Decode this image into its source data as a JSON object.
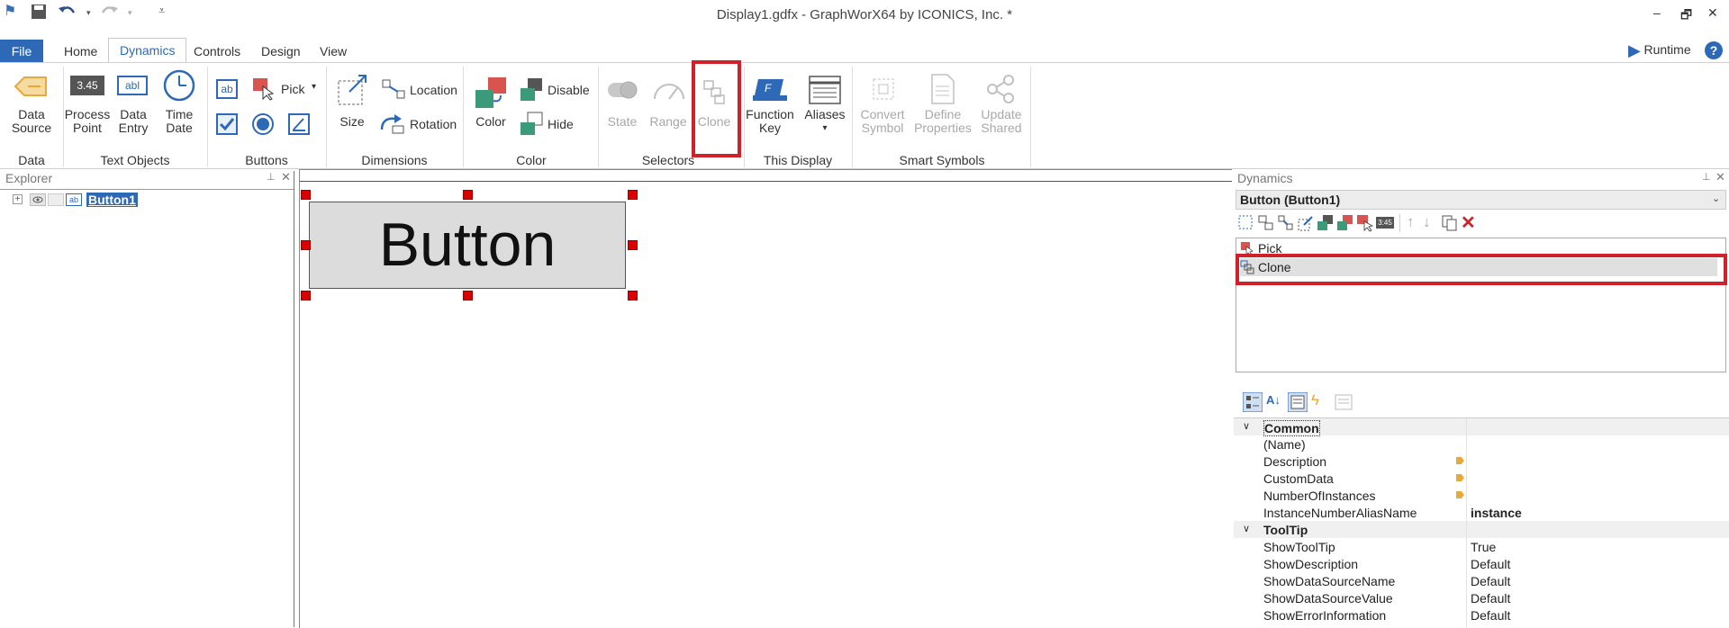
{
  "window": {
    "title": "Display1.gdfx - GraphWorX64 by ICONICS, Inc. *",
    "controls": [
      "‒",
      "🗗",
      "✕"
    ]
  },
  "tabs": [
    "File",
    "Home",
    "Dynamics",
    "Controls",
    "Design",
    "View"
  ],
  "runtime_label": "Runtime",
  "help_label": "?",
  "ribbon": {
    "data_source": "Data Source",
    "data_source_l1": "Data",
    "data_source_l2": "Source",
    "process_point_l1": "Process",
    "process_point_l2": "Point",
    "process_point_icon_text": "3.45",
    "data_entry_l1": "Data",
    "data_entry_l2": "Entry",
    "data_entry_icon_text": "abl",
    "time_date_l1": "Time",
    "time_date_l2": "Date",
    "pick": "Pick",
    "size": "Size",
    "location": "Location",
    "rotation": "Rotation",
    "color": "Color",
    "disable": "Disable",
    "hide": "Hide",
    "state": "State",
    "range": "Range",
    "clone": "Clone",
    "function_key_l1": "Function",
    "function_key_l2": "Key",
    "aliases": "Aliases",
    "aliases_arrow": "▾",
    "convert_symbol_l1": "Convert",
    "convert_symbol_l2": "Symbol",
    "define_properties_l1": "Define",
    "define_properties_l2": "Properties",
    "update_shared_l1": "Update",
    "update_shared_l2": "Shared",
    "button_icon_text": "ab",
    "groups": {
      "data": "Data",
      "text_objects": "Text Objects",
      "buttons": "Buttons",
      "dimensions": "Dimensions",
      "color": "Color",
      "selectors": "Selectors",
      "this_display": "This Display",
      "smart_symbols": "Smart Symbols"
    }
  },
  "explorer": {
    "title": "Explorer",
    "node_label": "Button1",
    "node_icon_text": "ab"
  },
  "canvas": {
    "button_text": "Button"
  },
  "dynamics": {
    "title": "Dynamics",
    "object_selector": "Button (Button1)",
    "toolbar_text": "3:45",
    "list": [
      "Pick",
      "Clone"
    ],
    "properties": [
      {
        "category": true,
        "name": "Common"
      },
      {
        "name": "(Name)",
        "value": ""
      },
      {
        "name": "Description",
        "value": "",
        "tag": true
      },
      {
        "name": "CustomData",
        "value": "",
        "tag": true
      },
      {
        "name": "NumberOfInstances",
        "value": "",
        "tag": true
      },
      {
        "name": "InstanceNumberAliasName",
        "value": "instance",
        "bold": true
      },
      {
        "category": true,
        "name": "ToolTip"
      },
      {
        "name": "ShowToolTip",
        "value": "True"
      },
      {
        "name": "ShowDescription",
        "value": "Default"
      },
      {
        "name": "ShowDataSourceName",
        "value": "Default"
      },
      {
        "name": "ShowDataSourceValue",
        "value": "Default"
      },
      {
        "name": "ShowErrorInformation",
        "value": "Default"
      }
    ]
  },
  "colors": {
    "accent": "#2e69b8",
    "highlight_box": "#d0202a",
    "handle": "#d80000"
  }
}
